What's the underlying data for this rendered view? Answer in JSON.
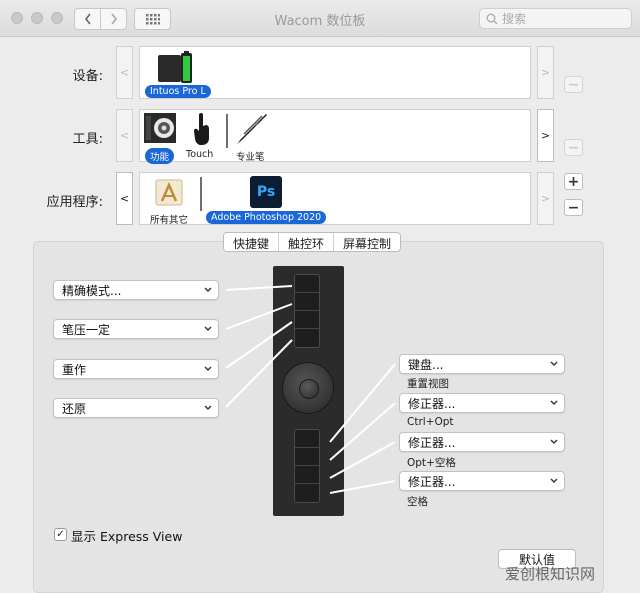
{
  "window": {
    "title": "Wacom 数位板"
  },
  "search": {
    "placeholder": "搜索"
  },
  "rows": {
    "device": {
      "label": "设备:",
      "item_label": "Intuos Pro L"
    },
    "tool": {
      "label": "工具:",
      "items": [
        "功能",
        "Touch",
        "专业笔"
      ]
    },
    "app": {
      "label": "应用程序:",
      "items": [
        "所有其它",
        "Adobe Photoshop 2020"
      ],
      "ps_icon_text": "Ps"
    }
  },
  "tabs": [
    "快捷键",
    "触控环",
    "屏幕控制"
  ],
  "left_keys": [
    "精确模式...",
    "笔压一定",
    "重作",
    "还原"
  ],
  "right_keys": [
    {
      "value": "键盘...",
      "sub": "重置视图"
    },
    {
      "value": "修正器...",
      "sub": "Ctrl+Opt"
    },
    {
      "value": "修正器...",
      "sub": "Opt+空格"
    },
    {
      "value": "修正器...",
      "sub": "空格"
    }
  ],
  "express_view": {
    "label": "显示 Express View",
    "checked": "✓"
  },
  "default_button": "默认值",
  "watermark": "爱创根知识网",
  "colors": {
    "selection": "#1a67d8",
    "ps_bg": "#0b1c33",
    "ps_text": "#31a8ff",
    "battery": "#2ecc40"
  }
}
